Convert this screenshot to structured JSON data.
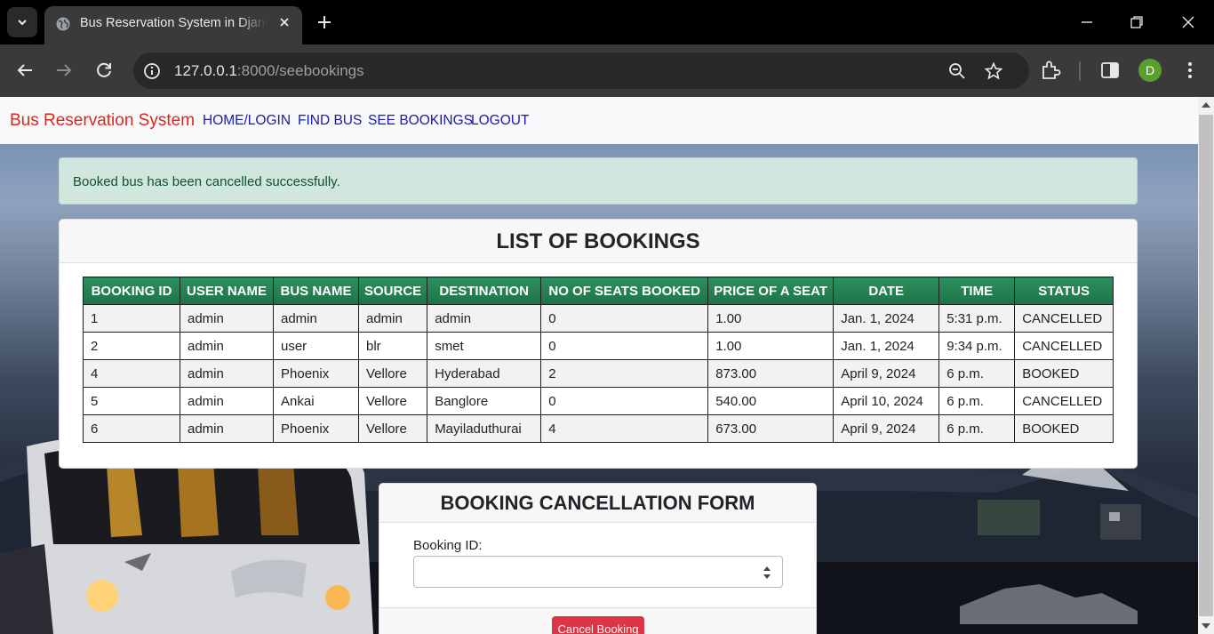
{
  "browser": {
    "tab_title": "Bus Reservation System in Django",
    "url_host": "127.0.0.1",
    "url_path": ":8000/seebookings",
    "profile_initial": "D"
  },
  "navbar": {
    "brand": "Bus Reservation System",
    "links": [
      "HOME/LOGIN",
      "FIND BUS",
      "SEE BOOKINGS",
      "LOGOUT"
    ]
  },
  "alert": {
    "message": "Booked bus has been cancelled successfully."
  },
  "bookings": {
    "title": "LIST OF BOOKINGS",
    "columns": [
      "BOOKING ID",
      "USER NAME",
      "BUS NAME",
      "SOURCE",
      "DESTINATION",
      "NO OF SEATS BOOKED",
      "PRICE OF A SEAT",
      "DATE",
      "TIME",
      "STATUS"
    ],
    "rows": [
      [
        "1",
        "admin",
        "admin",
        "admin",
        "admin",
        "0",
        "1.00",
        "Jan. 1, 2024",
        "5:31 p.m.",
        "CANCELLED"
      ],
      [
        "2",
        "admin",
        "user",
        "blr",
        "smet",
        "0",
        "1.00",
        "Jan. 1, 2024",
        "9:34 p.m.",
        "CANCELLED"
      ],
      [
        "4",
        "admin",
        "Phoenix",
        "Vellore",
        "Hyderabad",
        "2",
        "873.00",
        "April 9, 2024",
        "6 p.m.",
        "BOOKED"
      ],
      [
        "5",
        "admin",
        "Ankai",
        "Vellore",
        "Banglore",
        "0",
        "540.00",
        "April 10, 2024",
        "6 p.m.",
        "CANCELLED"
      ],
      [
        "6",
        "admin",
        "Phoenix",
        "Vellore",
        "Mayiladuthurai",
        "4",
        "673.00",
        "April 9, 2024",
        "6 p.m.",
        "BOOKED"
      ]
    ]
  },
  "cancel_form": {
    "title": "BOOKING CANCELLATION FORM",
    "label": "Booking ID:",
    "value": "",
    "button": "Cancel Booking"
  },
  "colors": {
    "brand": "#e0251b",
    "nav_link": "#1a1aad",
    "table_header": "#1f7347",
    "alert_bg": "#d1e7dd",
    "danger": "#dc3545"
  }
}
